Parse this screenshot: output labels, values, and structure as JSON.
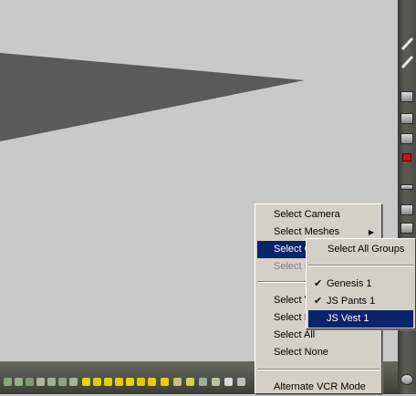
{
  "context_menu": {
    "items": [
      {
        "label": "Select Camera"
      },
      {
        "label": "Select Meshes"
      },
      {
        "label": "Select G"
      },
      {
        "label": "Select I"
      },
      {
        "label": "Select V"
      },
      {
        "label": "Select I"
      },
      {
        "label": "Select All"
      },
      {
        "label": "Select None"
      },
      {
        "label": "Alternate VCR Mode"
      }
    ]
  },
  "groups_submenu": {
    "select_all": "Select All Groups",
    "items": [
      {
        "label": "Genesis 1",
        "checked": true
      },
      {
        "label": "JS Pants 1",
        "checked": true
      },
      {
        "label": "JS Vest 1",
        "checked": false
      }
    ]
  },
  "colors": {
    "menu_bg": "#d4d0c8",
    "highlight": "#0a246a",
    "viewport_bg": "#c9c9c9",
    "shape": "#5a5a5a"
  }
}
